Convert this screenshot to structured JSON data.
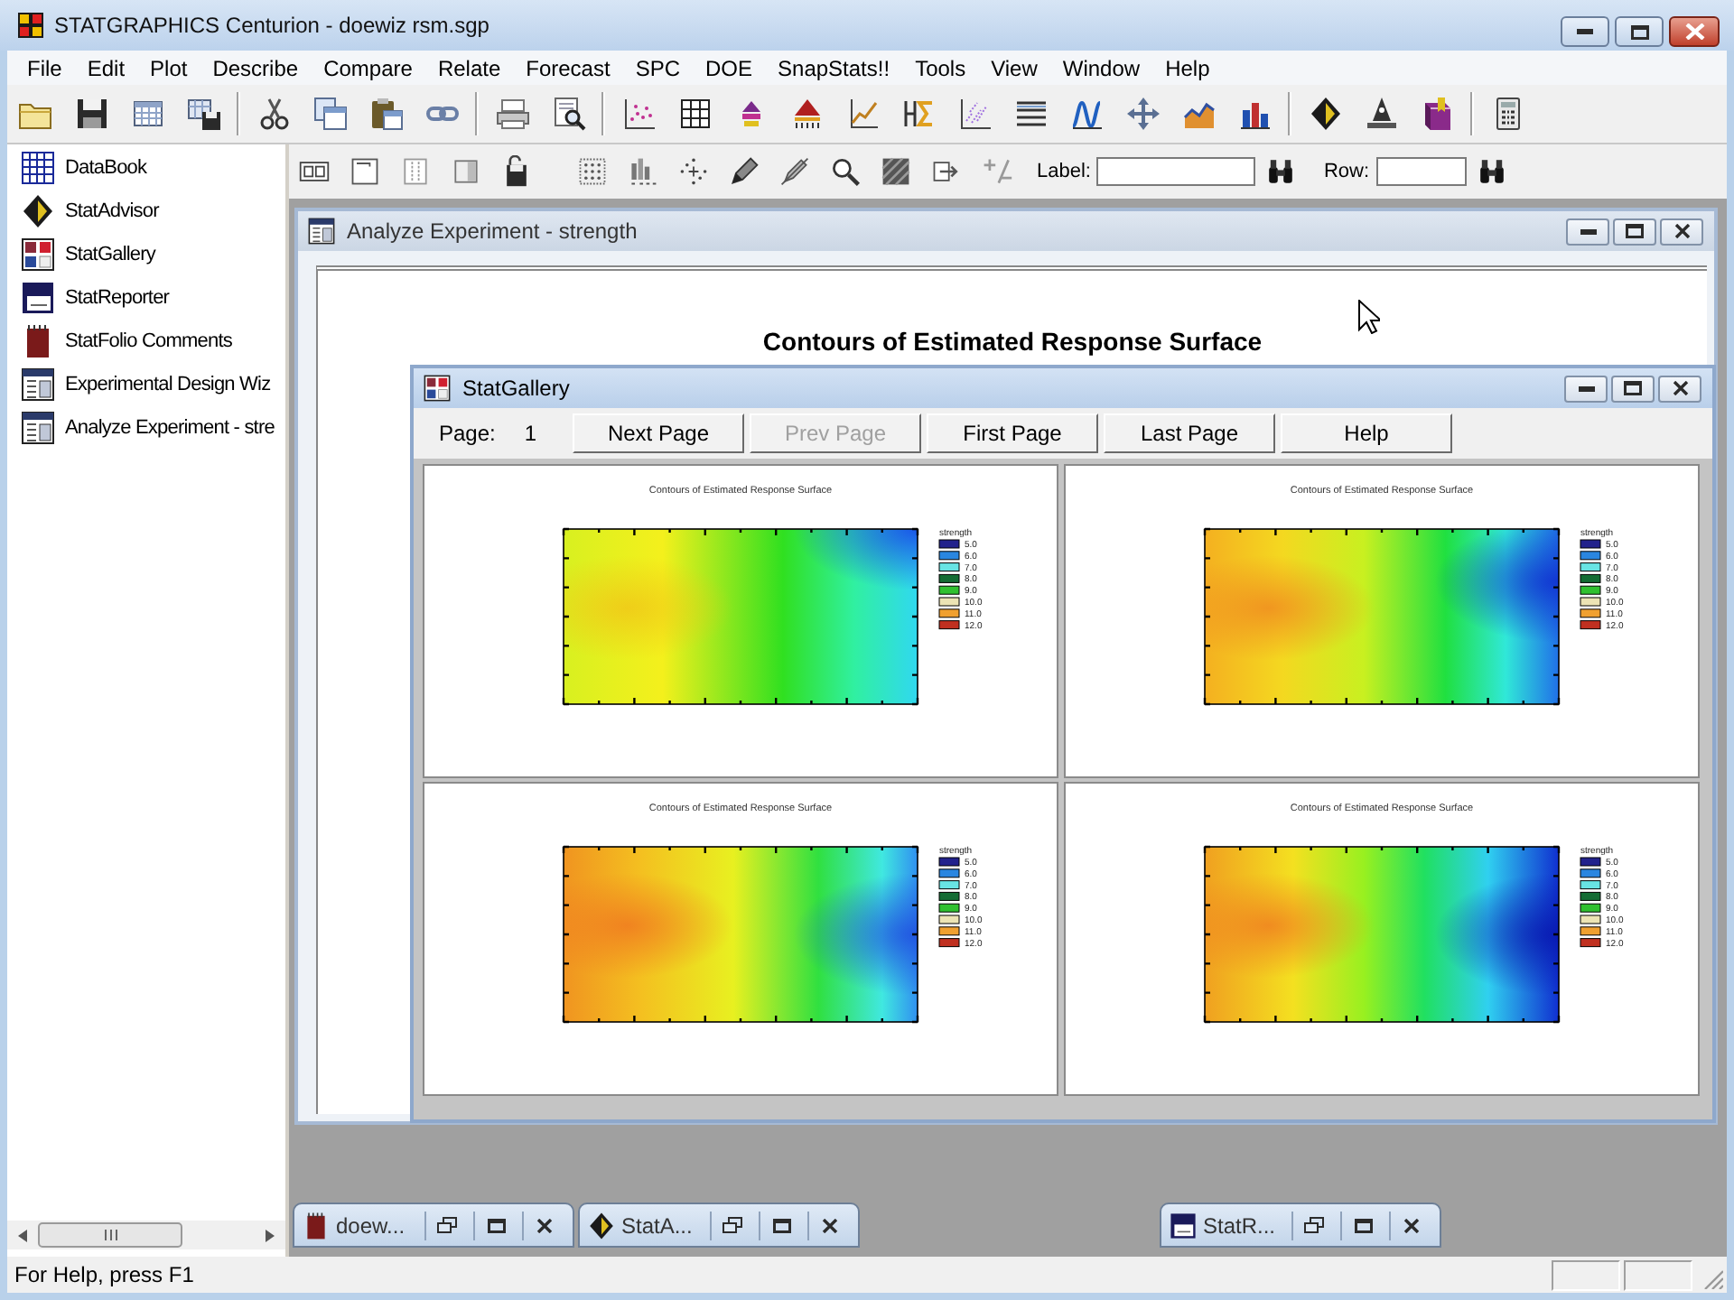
{
  "window": {
    "title": "STATGRAPHICS Centurion - doewiz rsm.sgp"
  },
  "menu": [
    "File",
    "Edit",
    "Plot",
    "Describe",
    "Compare",
    "Relate",
    "Forecast",
    "SPC",
    "DOE",
    "SnapStats!!",
    "Tools",
    "View",
    "Window",
    "Help"
  ],
  "sidebar": {
    "items": [
      {
        "label": "DataBook",
        "kind": "databook"
      },
      {
        "label": "StatAdvisor",
        "kind": "advisor"
      },
      {
        "label": "StatGallery",
        "kind": "gallery"
      },
      {
        "label": "StatReporter",
        "kind": "reporter"
      },
      {
        "label": "StatFolio Comments",
        "kind": "comments"
      },
      {
        "label": "Experimental Design Wiz",
        "kind": "analysis"
      },
      {
        "label": "Analyze Experiment - stre",
        "kind": "analysis"
      }
    ]
  },
  "find_bar": {
    "label_caption": "Label:",
    "row_caption": "Row:"
  },
  "analysis_window": {
    "title": "Analyze Experiment - strength",
    "heading": "Contours of Estimated Response Surface"
  },
  "gallery": {
    "title": "StatGallery",
    "page_caption": "Page:",
    "page": "1",
    "buttons": [
      {
        "label": "Next Page",
        "disabled": false
      },
      {
        "label": "Prev Page",
        "disabled": true
      },
      {
        "label": "First Page",
        "disabled": false
      },
      {
        "label": "Last Page",
        "disabled": false
      },
      {
        "label": "Help",
        "disabled": false
      }
    ],
    "plots": [
      {
        "title": "Contours of Estimated Response Surface",
        "legend_title": "strength",
        "legend": [
          {
            "label": "5.0",
            "color": "#22228c"
          },
          {
            "label": "6.0",
            "color": "#2a86e0"
          },
          {
            "label": "7.0",
            "color": "#68e4e4"
          },
          {
            "label": "8.0",
            "color": "#146c34"
          },
          {
            "label": "9.0",
            "color": "#30c030"
          },
          {
            "label": "10.0",
            "color": "#ece4b4"
          },
          {
            "label": "11.0",
            "color": "#f0a030"
          },
          {
            "label": "12.0",
            "color": "#c03020"
          }
        ]
      },
      {
        "title": "Contours of Estimated Response Surface",
        "legend_title": "strength",
        "legend": [
          {
            "label": "5.0",
            "color": "#22228c"
          },
          {
            "label": "6.0",
            "color": "#2a86e0"
          },
          {
            "label": "7.0",
            "color": "#68e4e4"
          },
          {
            "label": "8.0",
            "color": "#146c34"
          },
          {
            "label": "9.0",
            "color": "#30c030"
          },
          {
            "label": "10.0",
            "color": "#ece4b4"
          },
          {
            "label": "11.0",
            "color": "#f0a030"
          },
          {
            "label": "12.0",
            "color": "#c03020"
          }
        ]
      },
      {
        "title": "Contours of Estimated Response Surface",
        "legend_title": "strength",
        "legend": [
          {
            "label": "5.0",
            "color": "#22228c"
          },
          {
            "label": "6.0",
            "color": "#2a86e0"
          },
          {
            "label": "7.0",
            "color": "#68e4e4"
          },
          {
            "label": "8.0",
            "color": "#146c34"
          },
          {
            "label": "9.0",
            "color": "#30c030"
          },
          {
            "label": "10.0",
            "color": "#ece4b4"
          },
          {
            "label": "11.0",
            "color": "#f0a030"
          },
          {
            "label": "12.0",
            "color": "#c03020"
          }
        ]
      },
      {
        "title": "Contours of Estimated Response Surface",
        "legend_title": "strength",
        "legend": [
          {
            "label": "5.0",
            "color": "#22228c"
          },
          {
            "label": "6.0",
            "color": "#2a86e0"
          },
          {
            "label": "7.0",
            "color": "#68e4e4"
          },
          {
            "label": "8.0",
            "color": "#146c34"
          },
          {
            "label": "9.0",
            "color": "#30c030"
          },
          {
            "label": "10.0",
            "color": "#ece4b4"
          },
          {
            "label": "11.0",
            "color": "#f0a030"
          },
          {
            "label": "12.0",
            "color": "#c03020"
          }
        ]
      }
    ]
  },
  "minimized_windows": [
    {
      "title": "doew...",
      "kind": "comments"
    },
    {
      "title": "StatA...",
      "kind": "advisor"
    },
    {
      "title": "StatR...",
      "kind": "reporter"
    }
  ],
  "status_bar": {
    "text": "For Help, press F1"
  }
}
